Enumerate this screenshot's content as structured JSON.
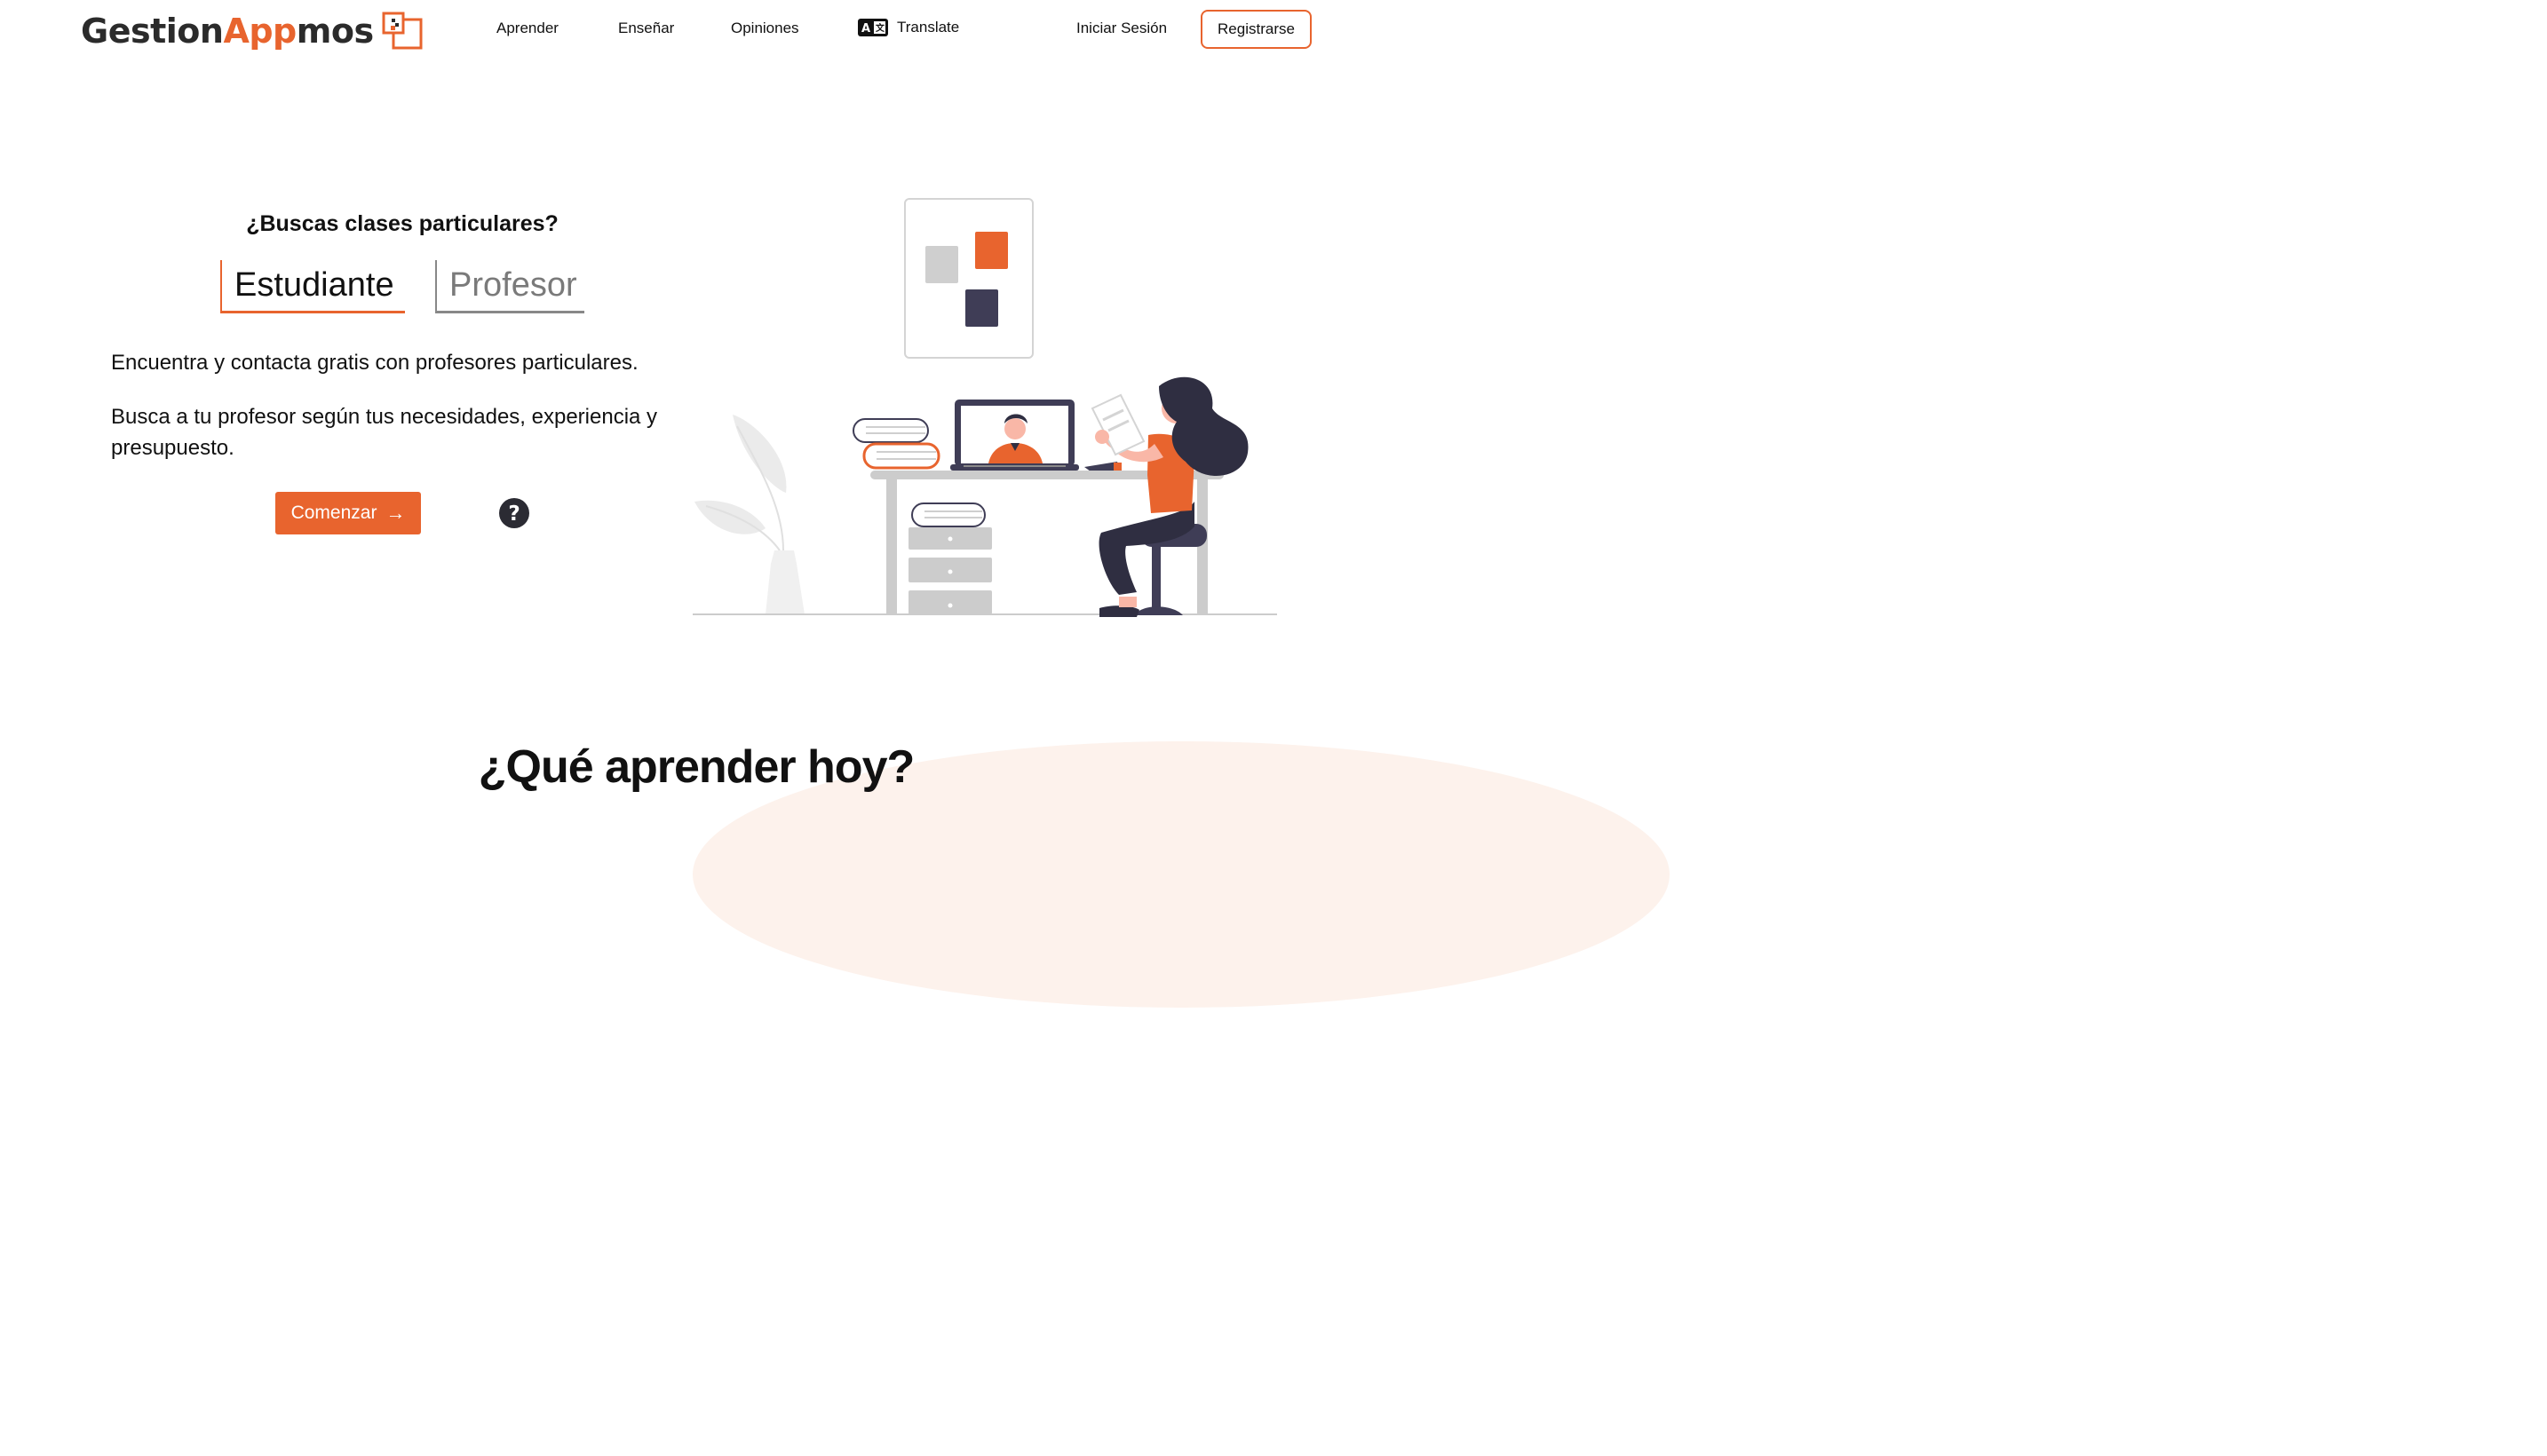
{
  "header": {
    "logo": {
      "part1": "Gestion",
      "part2": "App",
      "part3": "mos"
    },
    "nav": {
      "learn": "Aprender",
      "teach": "Enseñar",
      "reviews": "Opiniones",
      "translate": "Translate"
    },
    "login": "Iniciar Sesión",
    "register": "Registrarse"
  },
  "hero": {
    "question": "¿Buscas clases particulares?",
    "tabs": {
      "student": "Estudiante",
      "teacher": "Profesor"
    },
    "active_tab": "Estudiante",
    "paragraph1": "Encuentra y contacta gratis con profesores particulares.",
    "paragraph2": "Busca a tu profesor según tus necesidades, experiencia y presupuesto.",
    "start_button": "Comenzar",
    "start_icon": "arrow-right-icon",
    "help_icon": "question-circle-icon"
  },
  "section": {
    "title": "¿Qué aprender hoy?"
  },
  "colors": {
    "accent": "#e8642e",
    "dark": "#3f3d56",
    "grey": "#cccccc"
  }
}
